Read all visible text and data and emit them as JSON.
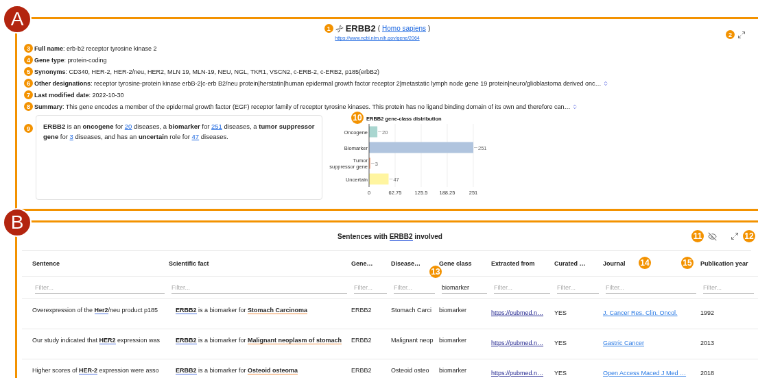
{
  "gene_panel": {
    "section_marker": "A",
    "header": {
      "marker": "1",
      "symbol": "ERBB2",
      "species_open": "(",
      "species": "Homo sapiens",
      "species_close": ")",
      "url": "https://www.ncbi.nlm.nih.gov/gene/2064"
    },
    "expand_marker": "2",
    "facts": [
      {
        "marker": "3",
        "text": "**Full name**: erb-b2 receptor tyrosine kinase 2",
        "expandable": false
      },
      {
        "marker": "4",
        "text": "**Gene type**: protein-coding",
        "expandable": false
      },
      {
        "marker": "5",
        "text": "**Synonyms**: CD340, HER-2, HER-2/neu, HER2, MLN 19, MLN-19, NEU, NGL, TKR1, VSCN2, c-ERB-2, c-ERB2, p185(erbB2)",
        "expandable": false
      },
      {
        "marker": "6",
        "text": "**Other designations**: receptor tyrosine-protein kinase erbB-2|c-erb B2/neu protein|herstatin|human epidermal growth factor receptor 2|metastatic lymph node gene 19 protein|neuro/glioblastoma derived onc…",
        "expandable": true
      },
      {
        "marker": "7",
        "text": "**Last modified date**: 2022-10-30",
        "expandable": false
      },
      {
        "marker": "8",
        "text": "**Summary**: This gene encodes a member of the epidermal growth factor (EGF) receptor family of receptor tyrosine kinases. This protein has no ligand binding domain of its own and therefore can…",
        "expandable": true
      }
    ],
    "class_summary": {
      "marker": "9",
      "parts": [
        {
          "kind": "bold",
          "text": "ERBB2"
        },
        {
          "kind": "plain",
          "text": " is an "
        },
        {
          "kind": "bold",
          "text": "oncogene"
        },
        {
          "kind": "plain",
          "text": " for "
        },
        {
          "kind": "link",
          "text": "20"
        },
        {
          "kind": "plain",
          "text": " diseases, a "
        },
        {
          "kind": "bold",
          "text": "biomarker"
        },
        {
          "kind": "plain",
          "text": " for "
        },
        {
          "kind": "link",
          "text": "251"
        },
        {
          "kind": "plain",
          "text": " diseases, a "
        },
        {
          "kind": "bold",
          "text": "tumor suppressor gene"
        },
        {
          "kind": "plain",
          "text": " for "
        },
        {
          "kind": "link",
          "text": "3"
        },
        {
          "kind": "plain",
          "text": " diseases, and has an "
        },
        {
          "kind": "bold",
          "text": "uncertain"
        },
        {
          "kind": "plain",
          "text": " role for "
        },
        {
          "kind": "link",
          "text": "47"
        },
        {
          "kind": "plain",
          "text": " diseases."
        }
      ]
    },
    "chart": {
      "marker": "10",
      "chart_data": {
        "type": "bar",
        "title": "ERBB2 gene-class distribution",
        "orientation": "horizontal",
        "data_labels": true,
        "grid": true,
        "series": [
          {
            "name": "Oncogene",
            "color": "#a9d6d0",
            "values": [
              20
            ]
          },
          {
            "name": "Biomarker",
            "color": "#b0c4de",
            "values": [
              251
            ]
          },
          {
            "name": "Tumor suppressor gene",
            "color": "#f4a582",
            "values": [
              3
            ]
          },
          {
            "name": "Uncertain",
            "color": "#fff5a0",
            "values": [
              47
            ]
          }
        ],
        "xlim": [
          0,
          251
        ],
        "xticks": [
          0,
          62.75,
          125.5,
          188.25,
          251
        ]
      }
    }
  },
  "sentences_panel": {
    "section_marker": "B",
    "title": {
      "before": "Sentences with",
      "gene": "ERBB2",
      "after": "involved"
    },
    "hide_marker": "11",
    "expand_marker": "12",
    "columns": [
      {
        "label": "Sentence",
        "filter": {
          "placeholder": "Filter..."
        }
      },
      {
        "label": "Scientific fact",
        "filter": {
          "placeholder": "Filter..."
        }
      },
      {
        "label": "Gene…",
        "filter": {
          "placeholder": "Filter..."
        }
      },
      {
        "label": "Disease…",
        "filter": {
          "placeholder": "Filter..."
        }
      },
      {
        "label": "Gene class",
        "marker": "13",
        "filter": {
          "value": "biomarker"
        }
      },
      {
        "label": "Extracted from",
        "filter": {
          "placeholder": "Filter..."
        }
      },
      {
        "label": "Curated …",
        "filter": {
          "placeholder": "Filter..."
        }
      },
      {
        "label": "Journal",
        "marker": "14",
        "filter": {
          "placeholder": "Filter..."
        }
      },
      {
        "label": "Publication year",
        "marker": "15",
        "filter": {
          "placeholder": "Filter..."
        }
      }
    ],
    "rows": [
      {
        "sentence": "Overexpression of the **Her2**/neu product p185",
        "fact": "**ERBB2** is a biomarker for **Stomach Carcinoma**",
        "gene": "ERBB2",
        "disease": "Stomach Carci",
        "gene_class": "biomarker",
        "source": "https://pubmed.n…",
        "curated": "YES",
        "journal": "J. Cancer Res. Clin. Oncol.",
        "year": "1992"
      },
      {
        "sentence": "Our study indicated that **HER2** expression was",
        "fact": "**ERBB2** is a biomarker for **Malignant neoplasm of stomach**",
        "gene": "ERBB2",
        "disease": "Malignant neop",
        "gene_class": "biomarker",
        "source": "https://pubmed.n…",
        "curated": "YES",
        "journal": "Gastric Cancer",
        "year": "2013"
      },
      {
        "sentence": "Higher scores of **HER-2** expression were asso",
        "fact": "**ERBB2** is a biomarker for **Osteoid osteoma**",
        "gene": "ERBB2",
        "disease": "Osteoid osteo",
        "gene_class": "biomarker",
        "source": "https://pubmed.n…",
        "curated": "YES",
        "journal": "Open Access Maced J Med …",
        "year": "2018"
      }
    ]
  }
}
